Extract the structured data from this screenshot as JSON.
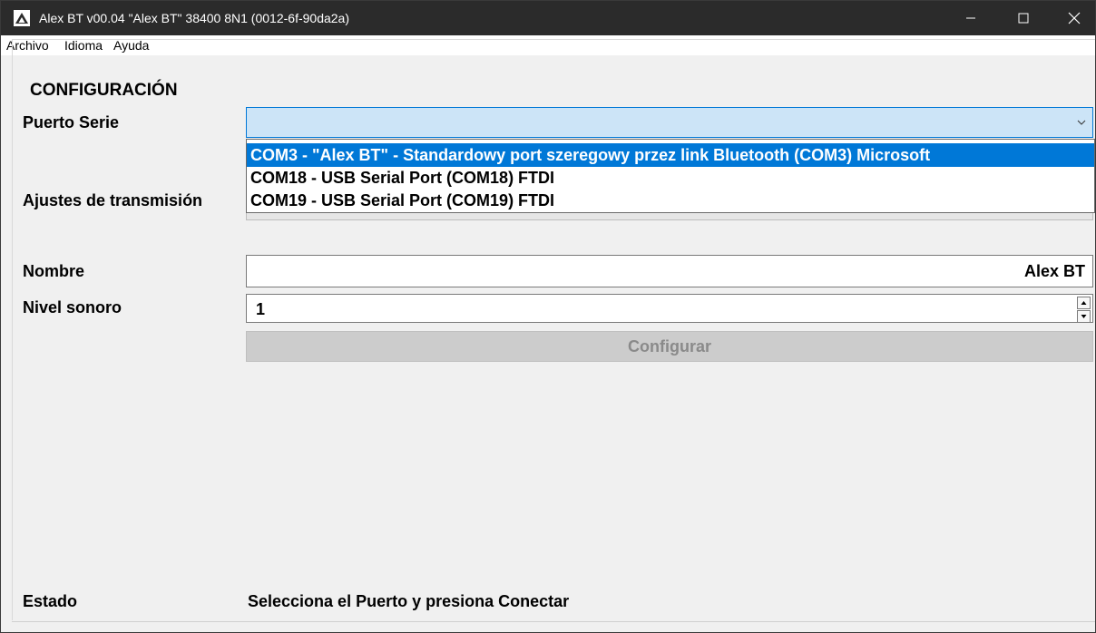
{
  "window": {
    "title": "Alex BT v00.04 \"Alex BT\" 38400 8N1 (0012-6f-90da2a)",
    "icon": "alex-logo-icon",
    "controls": [
      "minimize-icon",
      "maximize-icon",
      "close-icon"
    ]
  },
  "menu": {
    "items": [
      "Archivo",
      "Idioma",
      "Ayuda"
    ]
  },
  "config": {
    "group_title": "CONFIGURACIÓN",
    "serial_port_label": "Puerto Serie",
    "serial_port_value": "",
    "serial_port_options": [
      "COM3 - \"Alex BT\" - Standardowy port szeregowy przez link Bluetooth (COM3) Microsoft",
      "COM18 - USB Serial Port (COM18) FTDI",
      "COM19 - USB Serial Port (COM19) FTDI"
    ],
    "serial_port_highlighted_index": 0,
    "transmission_label": "Ajustes de transmisión",
    "name_label": "Nombre",
    "name_value": "Alex BT",
    "volume_label": "Nivel sonoro",
    "volume_value": "1",
    "configure_button": "Configurar"
  },
  "status": {
    "label": "Estado",
    "value": "Selecciona el Puerto y presiona Conectar"
  },
  "colors": {
    "titlebar": "#2b2b2b",
    "accent": "#0078d7",
    "combo_bg": "#cce4f7",
    "disabled_button": "#cccccc"
  }
}
